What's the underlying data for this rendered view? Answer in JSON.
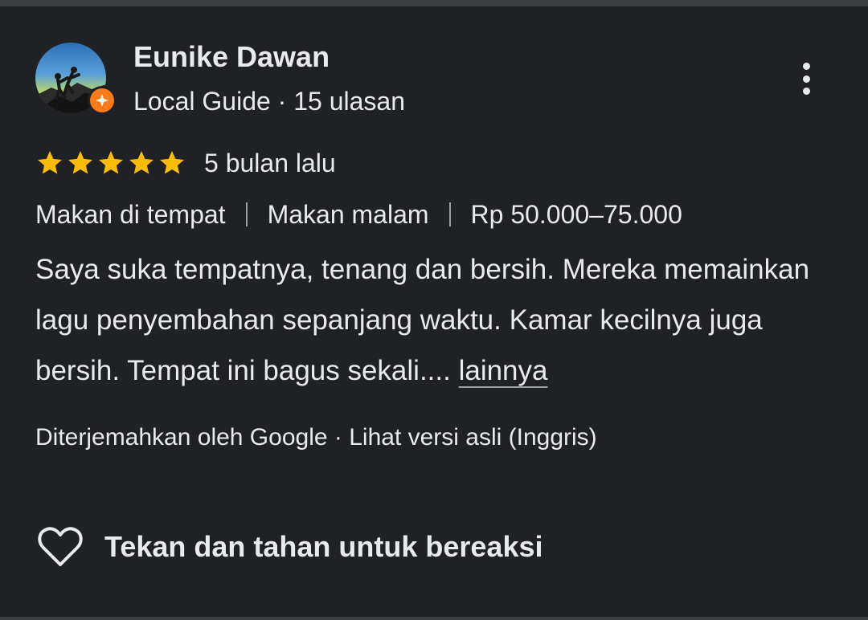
{
  "reviewer": {
    "name": "Eunike Dawan",
    "meta": "Local Guide · 15 ulasan",
    "avatar_icon": "avatar-photo",
    "badge_icon": "local-guide-star-icon",
    "badge_color": "#fa7b17"
  },
  "menu": {
    "icon": "more-vert-icon"
  },
  "rating": {
    "stars": 5,
    "max_stars": 5,
    "star_color": "#fbbc04",
    "date": "5 bulan lalu"
  },
  "tags": [
    "Makan di tempat",
    "Makan malam",
    "Rp 50.000–75.000"
  ],
  "review": {
    "text": "Saya suka tempatnya, tenang dan bersih. Mereka memainkan lagu penyembahan sepanjang waktu. Kamar kecilnya juga bersih. Tempat ini bagus sekali.... ",
    "more_label": "lainnya"
  },
  "translation": {
    "prefix": "Diterjemahkan oleh Google · ",
    "link_label": "Lihat versi asli (Inggris)"
  },
  "reaction": {
    "icon": "heart-outline-icon",
    "label": "Tekan dan tahan untuk bereaksi"
  },
  "theme": {
    "background": "#202124",
    "text": "#e8eaed",
    "border": "#3c4043"
  }
}
